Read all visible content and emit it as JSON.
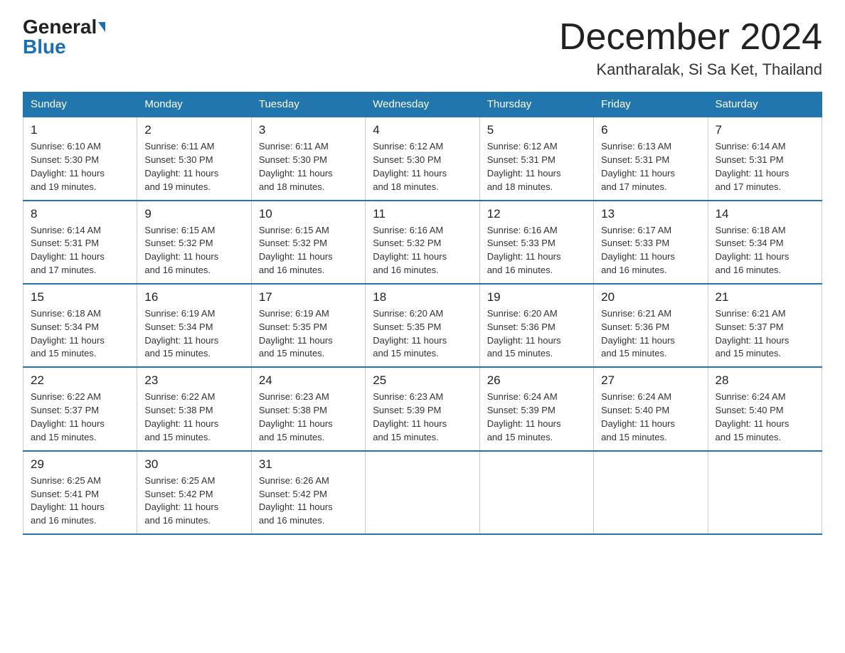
{
  "logo": {
    "general": "General",
    "blue": "Blue"
  },
  "header": {
    "month_year": "December 2024",
    "location": "Kantharalak, Si Sa Ket, Thailand"
  },
  "weekdays": [
    "Sunday",
    "Monday",
    "Tuesday",
    "Wednesday",
    "Thursday",
    "Friday",
    "Saturday"
  ],
  "weeks": [
    [
      {
        "day": "1",
        "sunrise": "6:10 AM",
        "sunset": "5:30 PM",
        "daylight": "11 hours and 19 minutes."
      },
      {
        "day": "2",
        "sunrise": "6:11 AM",
        "sunset": "5:30 PM",
        "daylight": "11 hours and 19 minutes."
      },
      {
        "day": "3",
        "sunrise": "6:11 AM",
        "sunset": "5:30 PM",
        "daylight": "11 hours and 18 minutes."
      },
      {
        "day": "4",
        "sunrise": "6:12 AM",
        "sunset": "5:30 PM",
        "daylight": "11 hours and 18 minutes."
      },
      {
        "day": "5",
        "sunrise": "6:12 AM",
        "sunset": "5:31 PM",
        "daylight": "11 hours and 18 minutes."
      },
      {
        "day": "6",
        "sunrise": "6:13 AM",
        "sunset": "5:31 PM",
        "daylight": "11 hours and 17 minutes."
      },
      {
        "day": "7",
        "sunrise": "6:14 AM",
        "sunset": "5:31 PM",
        "daylight": "11 hours and 17 minutes."
      }
    ],
    [
      {
        "day": "8",
        "sunrise": "6:14 AM",
        "sunset": "5:31 PM",
        "daylight": "11 hours and 17 minutes."
      },
      {
        "day": "9",
        "sunrise": "6:15 AM",
        "sunset": "5:32 PM",
        "daylight": "11 hours and 16 minutes."
      },
      {
        "day": "10",
        "sunrise": "6:15 AM",
        "sunset": "5:32 PM",
        "daylight": "11 hours and 16 minutes."
      },
      {
        "day": "11",
        "sunrise": "6:16 AM",
        "sunset": "5:32 PM",
        "daylight": "11 hours and 16 minutes."
      },
      {
        "day": "12",
        "sunrise": "6:16 AM",
        "sunset": "5:33 PM",
        "daylight": "11 hours and 16 minutes."
      },
      {
        "day": "13",
        "sunrise": "6:17 AM",
        "sunset": "5:33 PM",
        "daylight": "11 hours and 16 minutes."
      },
      {
        "day": "14",
        "sunrise": "6:18 AM",
        "sunset": "5:34 PM",
        "daylight": "11 hours and 16 minutes."
      }
    ],
    [
      {
        "day": "15",
        "sunrise": "6:18 AM",
        "sunset": "5:34 PM",
        "daylight": "11 hours and 15 minutes."
      },
      {
        "day": "16",
        "sunrise": "6:19 AM",
        "sunset": "5:34 PM",
        "daylight": "11 hours and 15 minutes."
      },
      {
        "day": "17",
        "sunrise": "6:19 AM",
        "sunset": "5:35 PM",
        "daylight": "11 hours and 15 minutes."
      },
      {
        "day": "18",
        "sunrise": "6:20 AM",
        "sunset": "5:35 PM",
        "daylight": "11 hours and 15 minutes."
      },
      {
        "day": "19",
        "sunrise": "6:20 AM",
        "sunset": "5:36 PM",
        "daylight": "11 hours and 15 minutes."
      },
      {
        "day": "20",
        "sunrise": "6:21 AM",
        "sunset": "5:36 PM",
        "daylight": "11 hours and 15 minutes."
      },
      {
        "day": "21",
        "sunrise": "6:21 AM",
        "sunset": "5:37 PM",
        "daylight": "11 hours and 15 minutes."
      }
    ],
    [
      {
        "day": "22",
        "sunrise": "6:22 AM",
        "sunset": "5:37 PM",
        "daylight": "11 hours and 15 minutes."
      },
      {
        "day": "23",
        "sunrise": "6:22 AM",
        "sunset": "5:38 PM",
        "daylight": "11 hours and 15 minutes."
      },
      {
        "day": "24",
        "sunrise": "6:23 AM",
        "sunset": "5:38 PM",
        "daylight": "11 hours and 15 minutes."
      },
      {
        "day": "25",
        "sunrise": "6:23 AM",
        "sunset": "5:39 PM",
        "daylight": "11 hours and 15 minutes."
      },
      {
        "day": "26",
        "sunrise": "6:24 AM",
        "sunset": "5:39 PM",
        "daylight": "11 hours and 15 minutes."
      },
      {
        "day": "27",
        "sunrise": "6:24 AM",
        "sunset": "5:40 PM",
        "daylight": "11 hours and 15 minutes."
      },
      {
        "day": "28",
        "sunrise": "6:24 AM",
        "sunset": "5:40 PM",
        "daylight": "11 hours and 15 minutes."
      }
    ],
    [
      {
        "day": "29",
        "sunrise": "6:25 AM",
        "sunset": "5:41 PM",
        "daylight": "11 hours and 16 minutes."
      },
      {
        "day": "30",
        "sunrise": "6:25 AM",
        "sunset": "5:42 PM",
        "daylight": "11 hours and 16 minutes."
      },
      {
        "day": "31",
        "sunrise": "6:26 AM",
        "sunset": "5:42 PM",
        "daylight": "11 hours and 16 minutes."
      },
      null,
      null,
      null,
      null
    ]
  ],
  "labels": {
    "sunrise": "Sunrise:",
    "sunset": "Sunset:",
    "daylight": "Daylight:"
  }
}
